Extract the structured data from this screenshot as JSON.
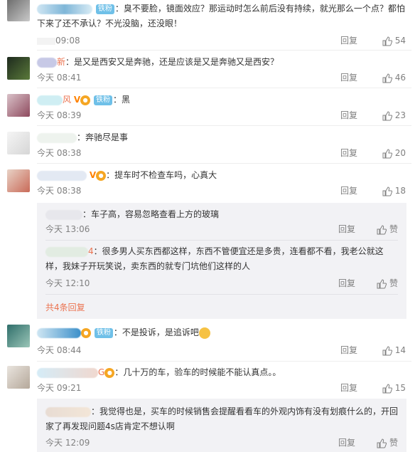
{
  "comments": [
    {
      "badge": "铁粉",
      "text": "：臭不要脸，镜面效应？那运动时怎么前后没有持续，就光那么一个点？都怕下来了还不承认？不光没脑，还没眼！",
      "time": "09:08",
      "reply": "回复",
      "likes": "54"
    },
    {
      "name_suffix": "新",
      "text": "：是又是西安又是奔驰，还是应该是又是奔驰又是西安？",
      "time": "今天 08:41",
      "reply": "回复",
      "likes": "46"
    },
    {
      "name_suffix": "风",
      "badge": "铁粉",
      "text": "：黑",
      "time": "今天 08:39",
      "reply": "回复",
      "likes": "23"
    },
    {
      "text": "：奔驰尽是事",
      "time": "今天 08:38",
      "reply": "回复",
      "likes": "20"
    },
    {
      "text": "：提车时不检查车吗，心真大",
      "time": "今天 08:38",
      "reply": "回复",
      "likes": "18"
    },
    {
      "badge": "铁粉",
      "text": "：不是投诉，是追诉吧",
      "time": "今天 08:44",
      "reply": "回复",
      "likes": "14"
    },
    {
      "name_suffix": "G",
      "text": "：几十万的车，验车的时候能不能认真点。。",
      "time": "今天 09:21",
      "reply": "回复",
      "likes": "15"
    }
  ],
  "subreplies": [
    {
      "text": "：车子高，容易忽略查看上方的玻璃",
      "time": "今天 13:06",
      "reply": "回复",
      "like": "赞"
    },
    {
      "name_suffix": "4",
      "text": "：很多男人买东西都这样，东西不管便宜还是多贵，连看都不看，我老公就这样，我妹子开玩笑说，卖东西的就专门坑他们这样的人",
      "time": "今天 12:10",
      "reply": "回复",
      "like": "赞"
    },
    {
      "text": "：我觉得也是，买车的时候销售会提醒看看车的外观内饰有没有划痕什么的，开回家了再发现问题4s店肯定不想认啊",
      "time": "今天 12:09",
      "reply": "回复",
      "like": "赞"
    }
  ],
  "more_replies": "共4条回复"
}
